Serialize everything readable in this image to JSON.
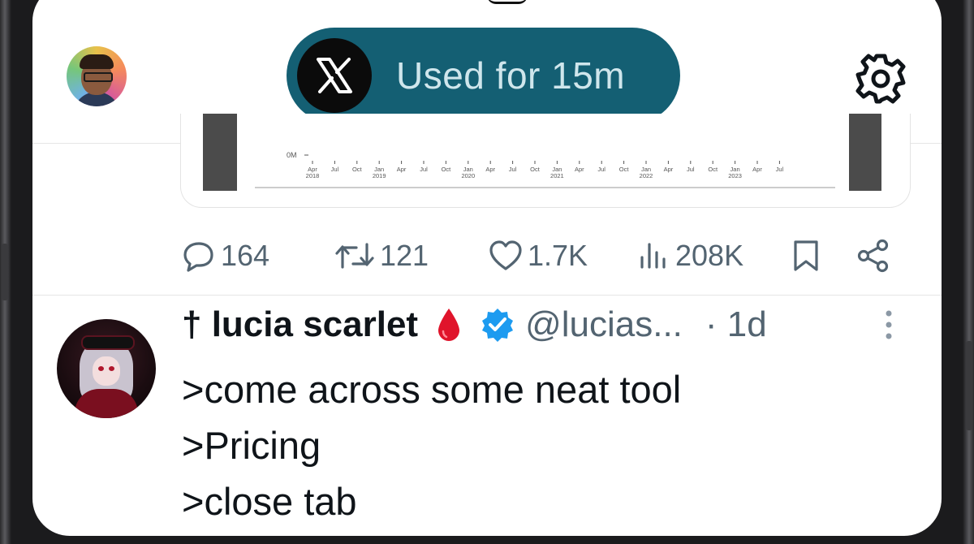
{
  "header": {
    "usage_label": "Used for 15m",
    "app_icon": "x-logo-icon",
    "settings_icon": "gear-icon"
  },
  "chart_preview": {
    "y_tick": "0M",
    "x_months": [
      "Apr",
      "Jul",
      "Oct",
      "Jan",
      "Apr",
      "Jul",
      "Oct",
      "Jan",
      "Apr",
      "Jul",
      "Oct",
      "Jan",
      "Apr",
      "Jul",
      "Oct",
      "Jan",
      "Apr",
      "Jul",
      "Oct",
      "Jan",
      "Apr",
      "Jul"
    ],
    "x_years": [
      "2018",
      "2019",
      "2020",
      "2021",
      "2022",
      "2023"
    ]
  },
  "post_actions": {
    "replies": "164",
    "reposts": "121",
    "likes": "1.7K",
    "views": "208K"
  },
  "tweet": {
    "name": "† lucia scarlet",
    "handle": "@lucias...",
    "time": "· 1d",
    "lines": [
      ">come across some neat tool",
      ">Pricing",
      ">close tab"
    ]
  },
  "colors": {
    "pill_bg": "#145f73",
    "verified": "#1d9bf0",
    "drop": "#e0142b",
    "muted": "#536471"
  }
}
